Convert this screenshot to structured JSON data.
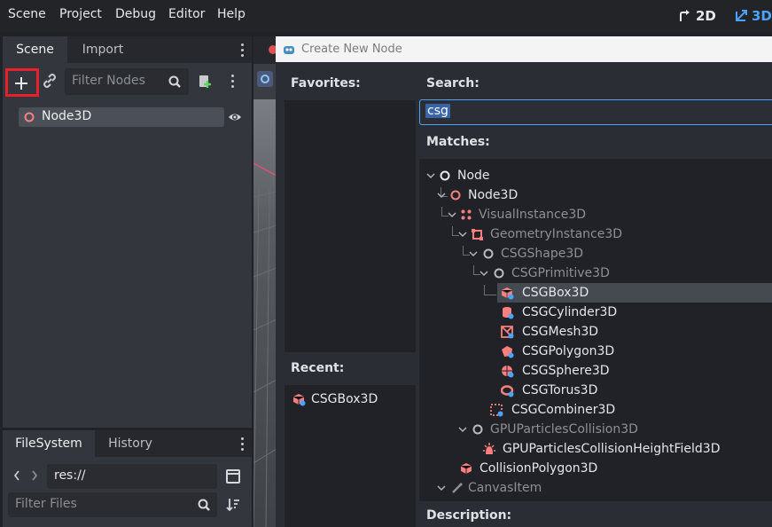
{
  "menu": [
    "Scene",
    "Project",
    "Debug",
    "Editor",
    "Help"
  ],
  "view_modes": {
    "two_d": "2D",
    "three_d": "3D"
  },
  "scene_dock": {
    "tabs": [
      "Scene",
      "Import"
    ],
    "filter_placeholder": "Filter Nodes",
    "tree": [
      {
        "label": "Node3D",
        "icon": "node3d-icon"
      }
    ]
  },
  "filesystem_dock": {
    "tabs": [
      "FileSystem",
      "History"
    ],
    "path": "res://",
    "filter_placeholder": "Filter Files"
  },
  "dialog": {
    "title": "Create New Node",
    "favorites_label": "Favorites:",
    "recent_label": "Recent:",
    "recent_items": [
      {
        "label": "CSGBox3D",
        "icon": "csgbox3d-icon"
      }
    ],
    "search_label": "Search:",
    "search_value": "csg",
    "matches_label": "Matches:",
    "description_label": "Description:",
    "matches": [
      {
        "label": "Node",
        "icon": "node-icon",
        "selected": false
      },
      {
        "label": "Node3D",
        "icon": "node3d-icon",
        "selected": false
      },
      {
        "label": "VisualInstance3D",
        "icon": "visualinstance3d-icon",
        "selected": false
      },
      {
        "label": "GeometryInstance3D",
        "icon": "geometryinstance3d-icon",
        "selected": false
      },
      {
        "label": "CSGShape3D",
        "icon": "csgshape3d-icon",
        "selected": false
      },
      {
        "label": "CSGPrimitive3D",
        "icon": "csgprimitive3d-icon",
        "selected": false
      },
      {
        "label": "CSGBox3D",
        "icon": "csgbox3d-icon",
        "selected": true
      },
      {
        "label": "CSGCylinder3D",
        "icon": "csgcylinder3d-icon",
        "selected": false
      },
      {
        "label": "CSGMesh3D",
        "icon": "csgmesh3d-icon",
        "selected": false
      },
      {
        "label": "CSGPolygon3D",
        "icon": "csgpolygon3d-icon",
        "selected": false
      },
      {
        "label": "CSGSphere3D",
        "icon": "csgsphere3d-icon",
        "selected": false
      },
      {
        "label": "CSGTorus3D",
        "icon": "csgtorus3d-icon",
        "selected": false
      },
      {
        "label": "CSGCombiner3D",
        "icon": "csgcombiner3d-icon",
        "selected": false
      },
      {
        "label": "GPUParticlesCollision3D",
        "icon": "gpuparticlescollision3d-icon",
        "selected": false
      },
      {
        "label": "GPUParticlesCollisionHeightField3D",
        "icon": "gpuparticlescollisionheightfield3d-icon",
        "selected": false
      },
      {
        "label": "CollisionPolygon3D",
        "icon": "collisionpolygon3d-icon",
        "selected": false
      },
      {
        "label": "CanvasItem",
        "icon": "canvasitem-icon",
        "selected": false
      }
    ]
  },
  "colors": {
    "node3d_red": "#fc7f7f",
    "accent_blue": "#4aa3ff",
    "highlight_red": "#e8202a",
    "panel_bg": "#202227",
    "dock_bg": "#33363d"
  }
}
